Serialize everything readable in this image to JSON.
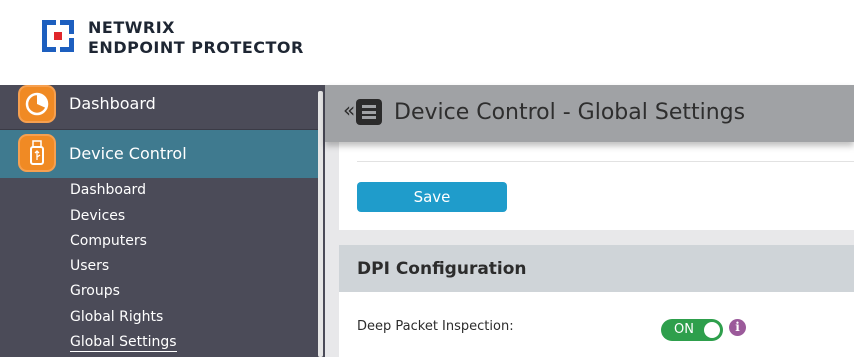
{
  "brand": {
    "line1": "NETWRIX",
    "line2": "ENDPOINT PROTECTOR",
    "colors": {
      "blue": "#1d5fbf",
      "red": "#e0262b"
    }
  },
  "sidebar": {
    "items": [
      {
        "label": "Dashboard",
        "icon": "dashboard-pie-icon",
        "active": false
      },
      {
        "label": "Device Control",
        "icon": "usb-drive-icon",
        "active": true
      }
    ],
    "subitems": [
      {
        "label": "Dashboard",
        "active": false
      },
      {
        "label": "Devices",
        "active": false
      },
      {
        "label": "Computers",
        "active": false
      },
      {
        "label": "Users",
        "active": false
      },
      {
        "label": "Groups",
        "active": false
      },
      {
        "label": "Global Rights",
        "active": false
      },
      {
        "label": "Global Settings",
        "active": true
      }
    ]
  },
  "header": {
    "title": "Device Control - Global Settings",
    "collapse_glyph": "«"
  },
  "actions": {
    "save_label": "Save"
  },
  "dpi": {
    "title": "DPI Configuration",
    "deep_packet_label": "Deep Packet Inspection:",
    "toggle_label": "ON",
    "toggle_on": true,
    "info_glyph": "i"
  },
  "colors": {
    "accent": "#1f9ccb",
    "sidebar_bg": "#4b4b58",
    "active_item_bg": "#3f7a8f",
    "icon_orange": "#f08a24",
    "toggle_green": "#2e9f4c",
    "info_purple": "#9b5a9a"
  }
}
